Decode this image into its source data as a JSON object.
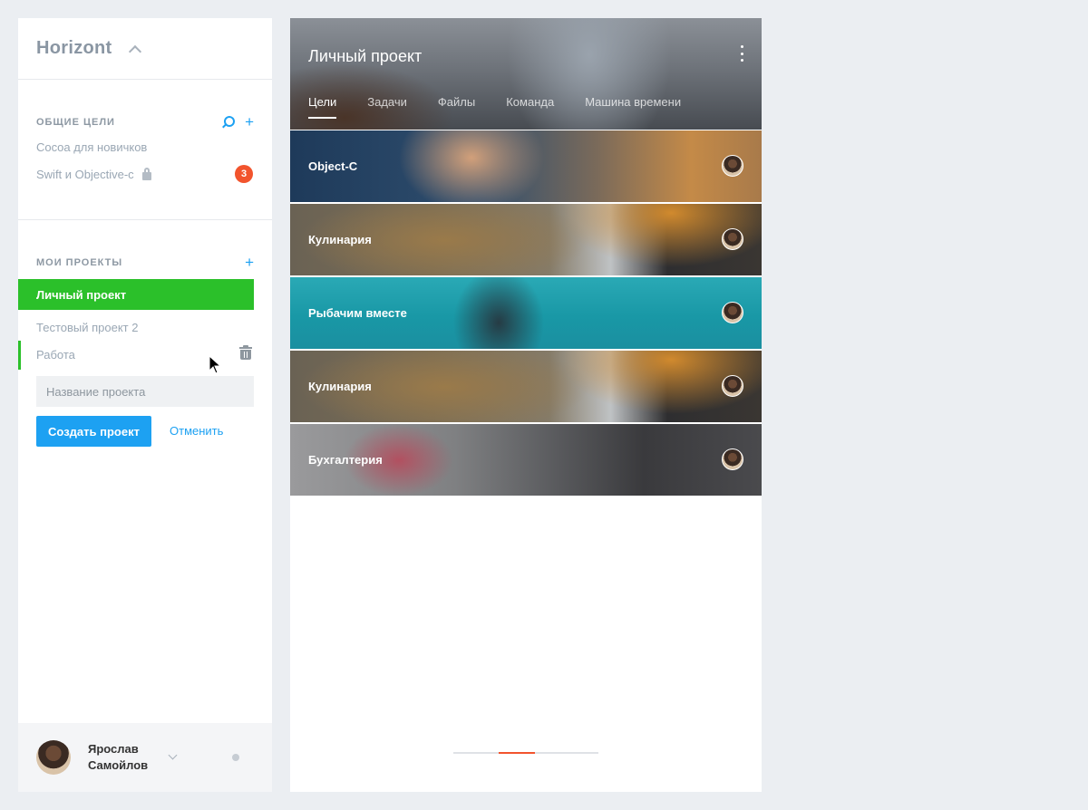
{
  "sidebar": {
    "brand": "Horizont",
    "shared_goals": {
      "title": "ОБЩИЕ ЦЕЛИ",
      "items": [
        {
          "label": "Cocoa для новичков"
        },
        {
          "label": "Swift и Objective-c",
          "badge": "3",
          "locked": true
        }
      ]
    },
    "my_projects": {
      "title": "МОИ ПРОЕКТЫ",
      "items": [
        {
          "label": "Личный проект",
          "active": true
        },
        {
          "label": "Тестовый проект 2"
        },
        {
          "label": "Работа"
        }
      ]
    },
    "new_project": {
      "placeholder": "Название проекта",
      "create_label": "Создать проект",
      "cancel_label": "Отменить"
    },
    "user": {
      "name": "Ярослав Самойлов"
    }
  },
  "main": {
    "title": "Личный проект",
    "tabs": [
      {
        "label": "Цели",
        "active": true
      },
      {
        "label": "Задачи"
      },
      {
        "label": "Файлы"
      },
      {
        "label": "Команда"
      },
      {
        "label": "Машина времени"
      }
    ],
    "goals": [
      {
        "label": "Object-C"
      },
      {
        "label": "Кулинария"
      },
      {
        "label": "Рыбачим вместе"
      },
      {
        "label": "Кулинария"
      },
      {
        "label": "Бухгалтерия"
      }
    ]
  },
  "colors": {
    "accent_blue": "#1da1f2",
    "active_green": "#2bc02a",
    "badge_orange": "#f2542d"
  },
  "icons": [
    "chevron-up-icon",
    "search-icon",
    "plus-icon",
    "lock-icon",
    "trash-icon",
    "more-vertical-icon",
    "chevron-down-icon"
  ]
}
